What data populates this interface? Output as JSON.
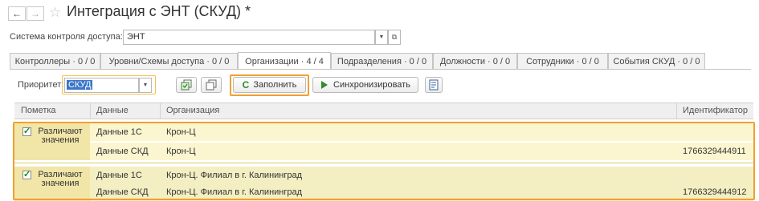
{
  "window": {
    "title": "Интеграция с ЭНТ (СКУД) *"
  },
  "nav": {
    "back": "←",
    "forward": "→",
    "star": "☆"
  },
  "system": {
    "label": "Система контроля доступа:",
    "value": "ЭНТ"
  },
  "tabs": [
    {
      "label": "Контроллеры · 0 / 0",
      "active": false
    },
    {
      "label": "Уровни/Схемы доступа · 0 / 0",
      "active": false
    },
    {
      "label": "Организации · 4 / 4",
      "active": true
    },
    {
      "label": "Подразделения · 0 / 0",
      "active": false
    },
    {
      "label": "Должности · 0 / 0",
      "active": false
    },
    {
      "label": "Сотрудники · 0 / 0",
      "active": false
    },
    {
      "label": "События СКУД · 0 / 0",
      "active": false
    }
  ],
  "toolbar": {
    "priority_label": "Приоритет:",
    "priority_value": "СКУД",
    "fill_label": "Заполнить",
    "sync_label": "Синхронизировать"
  },
  "table": {
    "columns": [
      "Пометка",
      "Данные",
      "Организация",
      "Идентификатор"
    ],
    "groups": [
      {
        "mark_text": "Различают значения",
        "checked": true,
        "rows": [
          {
            "data": "Данные 1С",
            "org": "Крон-Ц",
            "id": ""
          },
          {
            "data": "Данные СКД",
            "org": "Крон-Ц",
            "id": "1766329444911"
          }
        ]
      },
      {
        "mark_text": "Различают значения",
        "checked": true,
        "rows": [
          {
            "data": "Данные 1С",
            "org": "Крон-Ц. Филиал в г. Калининград",
            "id": ""
          },
          {
            "data": "Данные СКД",
            "org": "Крон-Ц. Филиал в г. Калининград",
            "id": "1766329444912"
          }
        ]
      }
    ]
  },
  "colors": {
    "highlight": "#f0a030",
    "row_bg": "#fbf6cf",
    "check": "#1a8a1a",
    "fill_icon": "#2e8b2e",
    "sync_icon": "#2e8b2e"
  }
}
